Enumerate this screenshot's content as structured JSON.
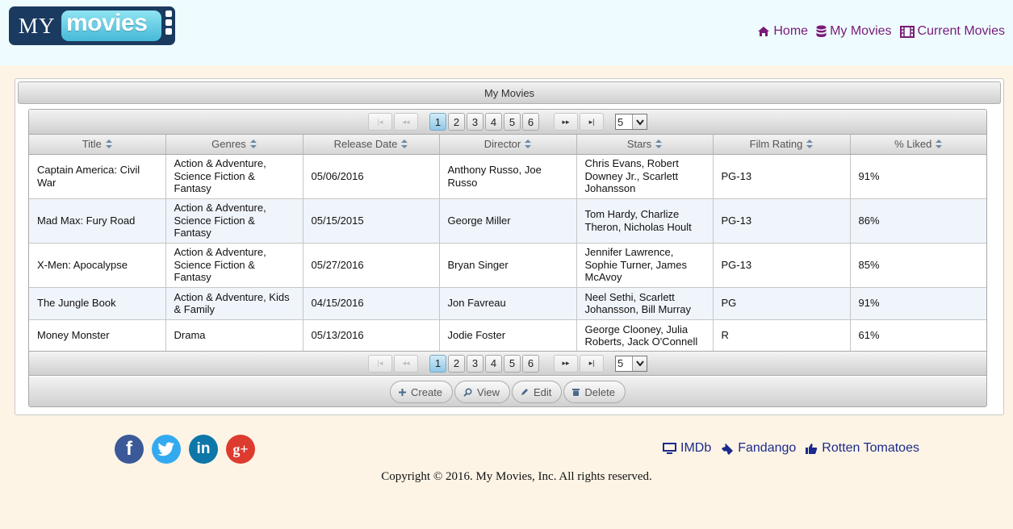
{
  "logo": {
    "part1": "MY",
    "part2": "movies"
  },
  "nav": [
    {
      "label": "Home",
      "icon": "home-icon"
    },
    {
      "label": "My Movies",
      "icon": "database-icon"
    },
    {
      "label": "Current Movies",
      "icon": "film-icon"
    }
  ],
  "panel_title": "My Movies",
  "pager": {
    "pages": [
      "1",
      "2",
      "3",
      "4",
      "5",
      "6"
    ],
    "current_page": "1",
    "page_size": "5",
    "active_color": "#8fc8e8"
  },
  "columns": [
    "Title",
    "Genres",
    "Release Date",
    "Director",
    "Stars",
    "Film Rating",
    "% Liked"
  ],
  "rows": [
    [
      "Captain America: Civil War",
      "Action & Adventure, Science Fiction & Fantasy",
      "05/06/2016",
      "Anthony Russo, Joe Russo",
      "Chris Evans, Robert Downey Jr., Scarlett Johansson",
      "PG-13",
      "91%"
    ],
    [
      "Mad Max: Fury Road",
      "Action & Adventure, Science Fiction & Fantasy",
      "05/15/2015",
      "George Miller",
      "Tom Hardy, Charlize Theron, Nicholas Hoult",
      "PG-13",
      "86%"
    ],
    [
      "X-Men: Apocalypse",
      "Action & Adventure, Science Fiction & Fantasy",
      "05/27/2016",
      "Bryan Singer",
      "Jennifer Lawrence, Sophie Turner, James McAvoy",
      "PG-13",
      "85%"
    ],
    [
      "The Jungle Book",
      "Action & Adventure, Kids & Family",
      "04/15/2016",
      "Jon Favreau",
      "Neel Sethi, Scarlett Johansson, Bill Murray",
      "PG",
      "91%"
    ],
    [
      "Money Monster",
      "Drama",
      "05/13/2016",
      "Jodie Foster",
      "George Clooney, Julia Roberts, Jack O'Connell",
      "R",
      "61%"
    ]
  ],
  "actions": [
    {
      "label": "Create",
      "icon": "plus-icon"
    },
    {
      "label": "View",
      "icon": "search-icon"
    },
    {
      "label": "Edit",
      "icon": "pencil-icon"
    },
    {
      "label": "Delete",
      "icon": "trash-icon"
    }
  ],
  "social": [
    {
      "name": "facebook-icon",
      "glyph": "f",
      "color": "#3b5998"
    },
    {
      "name": "twitter-icon",
      "glyph": "t",
      "color": "#33aaf0"
    },
    {
      "name": "linkedin-icon",
      "glyph": "in",
      "color": "#0e76a8"
    },
    {
      "name": "google-plus-icon",
      "glyph": "g+",
      "color": "#dd3b2e"
    }
  ],
  "footer_links": [
    {
      "label": "IMDb",
      "icon": "monitor-icon"
    },
    {
      "label": "Fandango",
      "icon": "ticket-icon"
    },
    {
      "label": "Rotten Tomatoes",
      "icon": "thumbs-up-icon"
    }
  ],
  "copyright": "Copyright © 2016. My Movies, Inc. All rights reserved.",
  "colors": {
    "header_bg": "#eefcff",
    "page_bg": "#fdf4e6",
    "nav_link": "#7a1b78",
    "footer_link": "#1c2a8c",
    "alt_row": "#f0f5fc"
  }
}
